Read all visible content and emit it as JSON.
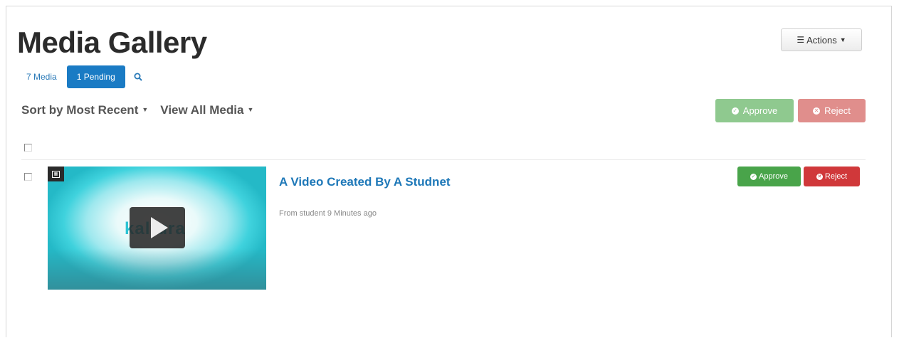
{
  "header": {
    "title": "Media Gallery",
    "actions_label": "Actions"
  },
  "tabs": {
    "media_label": "7 Media",
    "pending_label": "1 Pending"
  },
  "filters": {
    "sort_label": "Sort by Most Recent",
    "view_label": "View All Media"
  },
  "bulk_actions": {
    "approve_label": "Approve",
    "reject_label": "Reject"
  },
  "media_items": [
    {
      "title": "A Video Created By A Studnet",
      "meta": "From student 9 Minutes ago",
      "thumbnail_brand": "kaltura",
      "approve_label": "Approve",
      "reject_label": "Reject"
    }
  ],
  "colors": {
    "accent_blue": "#1a7bc4",
    "link_blue": "#1e78b8",
    "approve_green": "#49a44a",
    "reject_red": "#d0383a"
  },
  "icons": {
    "actions": "list-icon",
    "search": "search-icon",
    "approve": "check-circle-icon",
    "reject": "x-circle-icon",
    "play": "play-icon",
    "media_type": "video-type-icon"
  }
}
